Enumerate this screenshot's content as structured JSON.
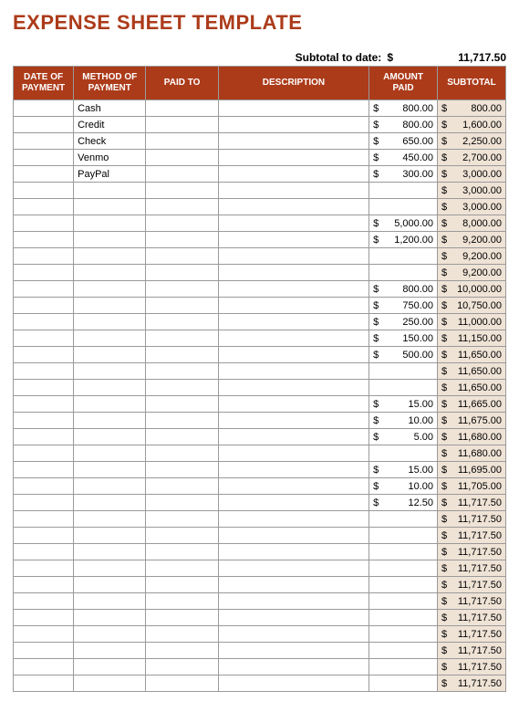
{
  "title": "EXPENSE SHEET TEMPLATE",
  "subtotal_label": "Subtotal to date:",
  "subtotal_currency": "$",
  "subtotal_value": "11,717.50",
  "headers": {
    "date": "DATE OF PAYMENT",
    "method": "METHOD OF PAYMENT",
    "paidto": "PAID TO",
    "desc": "DESCRIPTION",
    "amount": "AMOUNT PAID",
    "subtotal": "SUBTOTAL"
  },
  "chart_data": {
    "type": "table",
    "title": "Expense Sheet",
    "columns": [
      "Date of Payment",
      "Method of Payment",
      "Paid To",
      "Description",
      "Amount Paid",
      "Subtotal"
    ],
    "rows": [
      {
        "date": "",
        "method": "Cash",
        "paidto": "",
        "desc": "",
        "amount": "800.00",
        "subtotal": "800.00"
      },
      {
        "date": "",
        "method": "Credit",
        "paidto": "",
        "desc": "",
        "amount": "800.00",
        "subtotal": "1,600.00"
      },
      {
        "date": "",
        "method": "Check",
        "paidto": "",
        "desc": "",
        "amount": "650.00",
        "subtotal": "2,250.00"
      },
      {
        "date": "",
        "method": "Venmo",
        "paidto": "",
        "desc": "",
        "amount": "450.00",
        "subtotal": "2,700.00"
      },
      {
        "date": "",
        "method": "PayPal",
        "paidto": "",
        "desc": "",
        "amount": "300.00",
        "subtotal": "3,000.00"
      },
      {
        "date": "",
        "method": "",
        "paidto": "",
        "desc": "",
        "amount": "",
        "subtotal": "3,000.00"
      },
      {
        "date": "",
        "method": "",
        "paidto": "",
        "desc": "",
        "amount": "",
        "subtotal": "3,000.00"
      },
      {
        "date": "",
        "method": "",
        "paidto": "",
        "desc": "",
        "amount": "5,000.00",
        "subtotal": "8,000.00"
      },
      {
        "date": "",
        "method": "",
        "paidto": "",
        "desc": "",
        "amount": "1,200.00",
        "subtotal": "9,200.00"
      },
      {
        "date": "",
        "method": "",
        "paidto": "",
        "desc": "",
        "amount": "",
        "subtotal": "9,200.00"
      },
      {
        "date": "",
        "method": "",
        "paidto": "",
        "desc": "",
        "amount": "",
        "subtotal": "9,200.00"
      },
      {
        "date": "",
        "method": "",
        "paidto": "",
        "desc": "",
        "amount": "800.00",
        "subtotal": "10,000.00"
      },
      {
        "date": "",
        "method": "",
        "paidto": "",
        "desc": "",
        "amount": "750.00",
        "subtotal": "10,750.00"
      },
      {
        "date": "",
        "method": "",
        "paidto": "",
        "desc": "",
        "amount": "250.00",
        "subtotal": "11,000.00"
      },
      {
        "date": "",
        "method": "",
        "paidto": "",
        "desc": "",
        "amount": "150.00",
        "subtotal": "11,150.00"
      },
      {
        "date": "",
        "method": "",
        "paidto": "",
        "desc": "",
        "amount": "500.00",
        "subtotal": "11,650.00"
      },
      {
        "date": "",
        "method": "",
        "paidto": "",
        "desc": "",
        "amount": "",
        "subtotal": "11,650.00"
      },
      {
        "date": "",
        "method": "",
        "paidto": "",
        "desc": "",
        "amount": "",
        "subtotal": "11,650.00"
      },
      {
        "date": "",
        "method": "",
        "paidto": "",
        "desc": "",
        "amount": "15.00",
        "subtotal": "11,665.00"
      },
      {
        "date": "",
        "method": "",
        "paidto": "",
        "desc": "",
        "amount": "10.00",
        "subtotal": "11,675.00"
      },
      {
        "date": "",
        "method": "",
        "paidto": "",
        "desc": "",
        "amount": "5.00",
        "subtotal": "11,680.00"
      },
      {
        "date": "",
        "method": "",
        "paidto": "",
        "desc": "",
        "amount": "",
        "subtotal": "11,680.00"
      },
      {
        "date": "",
        "method": "",
        "paidto": "",
        "desc": "",
        "amount": "15.00",
        "subtotal": "11,695.00"
      },
      {
        "date": "",
        "method": "",
        "paidto": "",
        "desc": "",
        "amount": "10.00",
        "subtotal": "11,705.00"
      },
      {
        "date": "",
        "method": "",
        "paidto": "",
        "desc": "",
        "amount": "12.50",
        "subtotal": "11,717.50"
      },
      {
        "date": "",
        "method": "",
        "paidto": "",
        "desc": "",
        "amount": "",
        "subtotal": "11,717.50"
      },
      {
        "date": "",
        "method": "",
        "paidto": "",
        "desc": "",
        "amount": "",
        "subtotal": "11,717.50"
      },
      {
        "date": "",
        "method": "",
        "paidto": "",
        "desc": "",
        "amount": "",
        "subtotal": "11,717.50"
      },
      {
        "date": "",
        "method": "",
        "paidto": "",
        "desc": "",
        "amount": "",
        "subtotal": "11,717.50"
      },
      {
        "date": "",
        "method": "",
        "paidto": "",
        "desc": "",
        "amount": "",
        "subtotal": "11,717.50"
      },
      {
        "date": "",
        "method": "",
        "paidto": "",
        "desc": "",
        "amount": "",
        "subtotal": "11,717.50"
      },
      {
        "date": "",
        "method": "",
        "paidto": "",
        "desc": "",
        "amount": "",
        "subtotal": "11,717.50"
      },
      {
        "date": "",
        "method": "",
        "paidto": "",
        "desc": "",
        "amount": "",
        "subtotal": "11,717.50"
      },
      {
        "date": "",
        "method": "",
        "paidto": "",
        "desc": "",
        "amount": "",
        "subtotal": "11,717.50"
      },
      {
        "date": "",
        "method": "",
        "paidto": "",
        "desc": "",
        "amount": "",
        "subtotal": "11,717.50"
      },
      {
        "date": "",
        "method": "",
        "paidto": "",
        "desc": "",
        "amount": "",
        "subtotal": "11,717.50"
      }
    ]
  }
}
